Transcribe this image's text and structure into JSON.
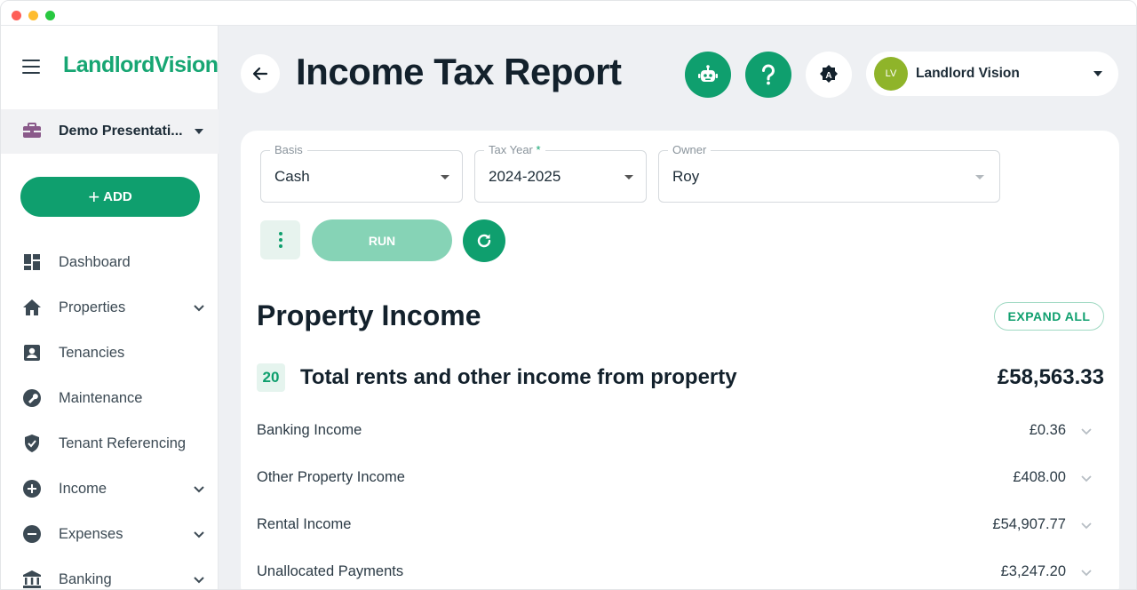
{
  "app": {
    "logo": "LandlordVision",
    "company": "Demo Presentati...",
    "add_label": "ADD"
  },
  "sidebar": {
    "items": [
      {
        "label": "Dashboard",
        "icon": "dashboard-icon",
        "expandable": false
      },
      {
        "label": "Properties",
        "icon": "home-icon",
        "expandable": true
      },
      {
        "label": "Tenancies",
        "icon": "contact-card-icon",
        "expandable": false
      },
      {
        "label": "Maintenance",
        "icon": "wrench-icon",
        "expandable": false
      },
      {
        "label": "Tenant Referencing",
        "icon": "shield-check-icon",
        "expandable": false
      },
      {
        "label": "Income",
        "icon": "plus-circle-icon",
        "expandable": true
      },
      {
        "label": "Expenses",
        "icon": "minus-circle-icon",
        "expandable": true
      },
      {
        "label": "Banking",
        "icon": "bank-icon",
        "expandable": true
      }
    ]
  },
  "header": {
    "title": "Income Tax Report",
    "icons": [
      "back-arrow-icon",
      "robot-icon",
      "help-icon",
      "accessibility-icon"
    ],
    "user": {
      "initials": "LV",
      "name": "Landlord Vision"
    }
  },
  "filters": {
    "basis": {
      "label": "Basis",
      "value": "Cash"
    },
    "tax_year": {
      "label": "Tax Year",
      "required_mark": "*",
      "value": "2024-2025"
    },
    "owner": {
      "label": "Owner",
      "value": "Roy"
    }
  },
  "actions": {
    "run_label": "RUN"
  },
  "report": {
    "section_title": "Property Income",
    "expand_label": "EXPAND ALL",
    "box_number": "20",
    "total_label": "Total rents and other income from property",
    "total_value": "£58,563.33",
    "rows": [
      {
        "label": "Banking Income",
        "value": "£0.36"
      },
      {
        "label": "Other Property Income",
        "value": "£408.00"
      },
      {
        "label": "Rental Income",
        "value": "£54,907.77"
      },
      {
        "label": "Unallocated Payments",
        "value": "£3,247.20"
      }
    ]
  },
  "colors": {
    "brand_green": "#0f9f6e",
    "run_disabled": "#86d3b6",
    "avatar": "#8fb42a"
  }
}
